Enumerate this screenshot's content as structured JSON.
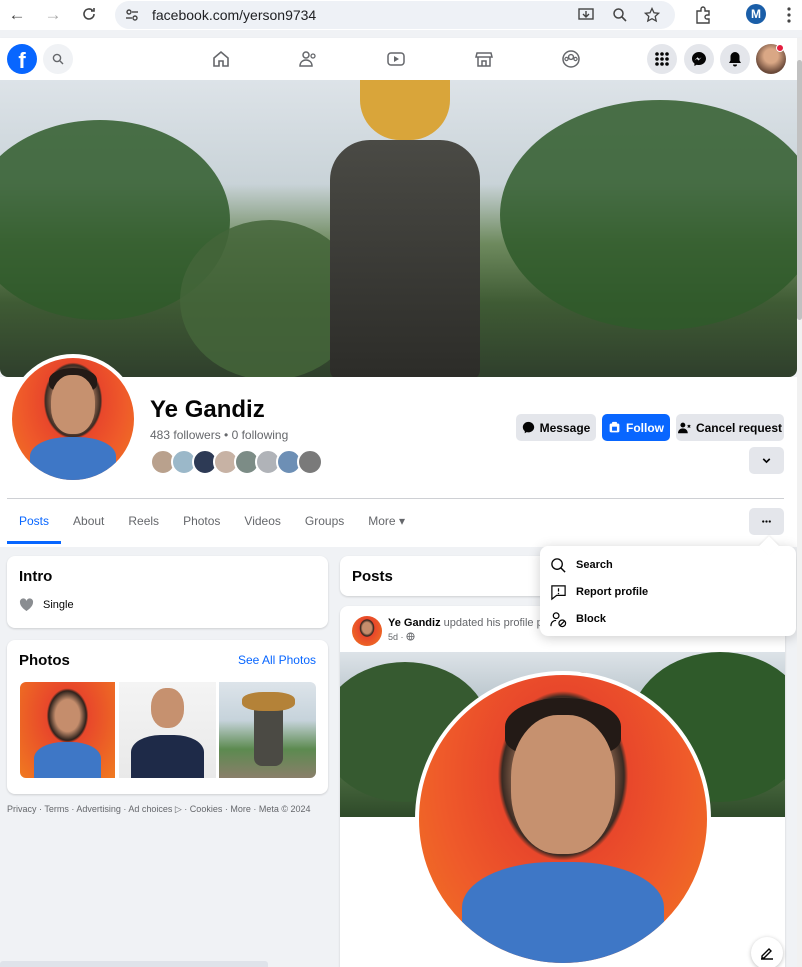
{
  "browser": {
    "url": "facebook.com/yerson9734",
    "profile_initial": "M"
  },
  "fb_nav": {
    "logo": "f",
    "icons": [
      "home-icon",
      "friends-icon",
      "video-icon",
      "marketplace-icon",
      "groups-icon"
    ]
  },
  "profile": {
    "name": "Ye Gandiz",
    "stats": "483 followers • 0 following",
    "friend_colors": [
      "#b9a18d",
      "#9bb8c9",
      "#2d3a55",
      "#c7b2a4",
      "#7c8c86",
      "#b0b3b8",
      "#6d8fb5",
      "#7a7a7a"
    ]
  },
  "actions": {
    "message": "Message",
    "follow": "Follow",
    "cancel": "Cancel request"
  },
  "tabs": [
    {
      "label": "Posts",
      "active": true
    },
    {
      "label": "About"
    },
    {
      "label": "Reels"
    },
    {
      "label": "Photos"
    },
    {
      "label": "Videos"
    },
    {
      "label": "Groups"
    },
    {
      "label": "More ▾"
    }
  ],
  "intro": {
    "title": "Intro",
    "relationship": "Single"
  },
  "photos": {
    "title": "Photos",
    "see_all": "See All Photos"
  },
  "footer": "Privacy · Terms · Advertising · Ad choices ▷ · Cookies · More · Meta © 2024",
  "posts": {
    "title": "Posts",
    "author": "Ye Gandiz",
    "action": "updated his profile p",
    "time": "5d ·"
  },
  "menu": {
    "search": "Search",
    "report": "Report profile",
    "block": "Block"
  },
  "colors": {
    "brand": "#0866ff",
    "button_gray": "#e4e6eb",
    "secondary_text": "#65676b"
  }
}
